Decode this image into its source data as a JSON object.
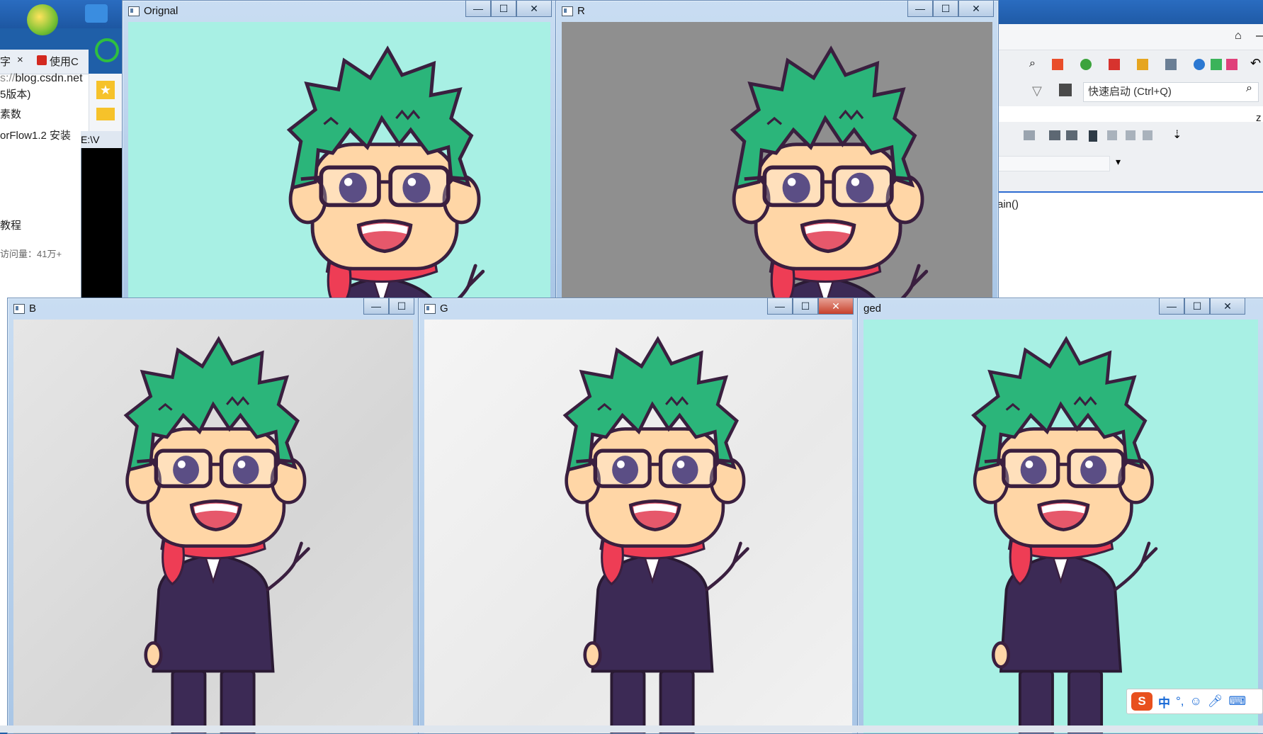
{
  "browser": {
    "tab1": "字",
    "tab2": "使用C",
    "url_prefix": "s://",
    "url_host": "blog.csdn.net",
    "items": [
      "5版本)",
      "素数",
      "orFlow1.2 安装",
      "教程",
      "访问量：41万+"
    ]
  },
  "console": {
    "title": "E:\\V"
  },
  "vs": {
    "search_placeholder": "快速启动 (Ctrl+Q)",
    "code": "ain()",
    "side_letter": "z"
  },
  "windows": {
    "original": {
      "title": "Orignal"
    },
    "r": {
      "title": "R"
    },
    "b": {
      "title": "B"
    },
    "g": {
      "title": "G"
    },
    "merged": {
      "title": "ged"
    }
  },
  "controls": {
    "min": "—",
    "max": "☐",
    "close": "✕"
  },
  "ime": {
    "chinese": "中",
    "punct": "°,"
  },
  "colors": {
    "teal": "#a8f0e4",
    "hair": "#2bb57a",
    "skin": "#ffd6a6",
    "scarf": "#ee3d55",
    "suit": "#3c2a55",
    "outline": "#3a1f3f"
  }
}
